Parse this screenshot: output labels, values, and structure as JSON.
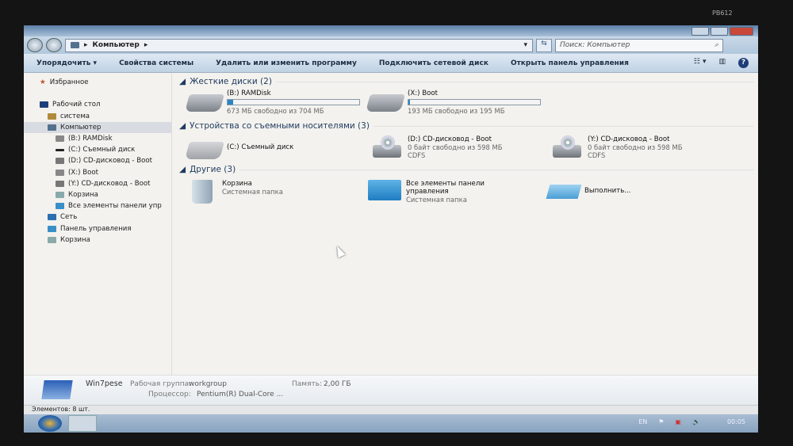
{
  "bezel_label": "PB612",
  "nav": {
    "breadcrumb": [
      "Компьютер"
    ],
    "search_placeholder": "Поиск: Компьютер"
  },
  "toolbar": {
    "organize": "Упорядочить",
    "system_properties": "Свойства системы",
    "uninstall": "Удалить или изменить программу",
    "map_drive": "Подключить сетевой диск",
    "open_control_panel": "Открыть панель управления"
  },
  "sidebar": {
    "items": [
      {
        "label": "Избранное"
      },
      {
        "label": "Рабочий стол"
      },
      {
        "label": "система"
      },
      {
        "label": "Компьютер"
      },
      {
        "label": "(B:) RAMDisk"
      },
      {
        "label": "(C:) Съемный диск"
      },
      {
        "label": "(D:) CD-дисковод - Boot"
      },
      {
        "label": "(X:) Boot"
      },
      {
        "label": "(Y:) CD-дисковод - Boot"
      },
      {
        "label": "Корзина"
      },
      {
        "label": "Все элементы панели упр"
      },
      {
        "label": "Сеть"
      },
      {
        "label": "Панель управления"
      },
      {
        "label": "Корзина"
      }
    ]
  },
  "groups": {
    "hard": {
      "title": "Жесткие диски (2)",
      "items": [
        {
          "name": "(B:) RAMDisk",
          "info": "673 МБ свободно из 704 МБ",
          "used_fraction": 0.044
        },
        {
          "name": "(X:) Boot",
          "info": "193 МБ свободно из 195 МБ",
          "used_fraction": 0.01
        }
      ]
    },
    "removable": {
      "title": "Устройства со съемными носителями (3)",
      "items": [
        {
          "name": "(C:) Съемный диск"
        },
        {
          "name": "(D:) CD-дисковод - Boot",
          "info": "0 байт свободно из 598 МБ",
          "fs": "CDFS"
        },
        {
          "name": "(Y:) CD-дисковод - Boot",
          "info": "0 байт свободно из 598 МБ",
          "fs": "CDFS"
        }
      ]
    },
    "other": {
      "title": "Другие (3)",
      "items": [
        {
          "name": "Корзина",
          "sub": "Системная папка"
        },
        {
          "name": "Все элементы панели управления",
          "sub": "Системная папка"
        },
        {
          "name": "Выполнить..."
        }
      ]
    }
  },
  "details": {
    "computer": "Win7pese",
    "workgroup_label": "Рабочая группа:",
    "workgroup": "workgroup",
    "memory_label": "Память:",
    "memory": "2,00 ГБ",
    "cpu_label": "Процессор:",
    "cpu": "Pentium(R) Dual-Core ..."
  },
  "status": "Элементов: 8 шт.",
  "tray": {
    "lang": "EN",
    "time": "00:05"
  }
}
